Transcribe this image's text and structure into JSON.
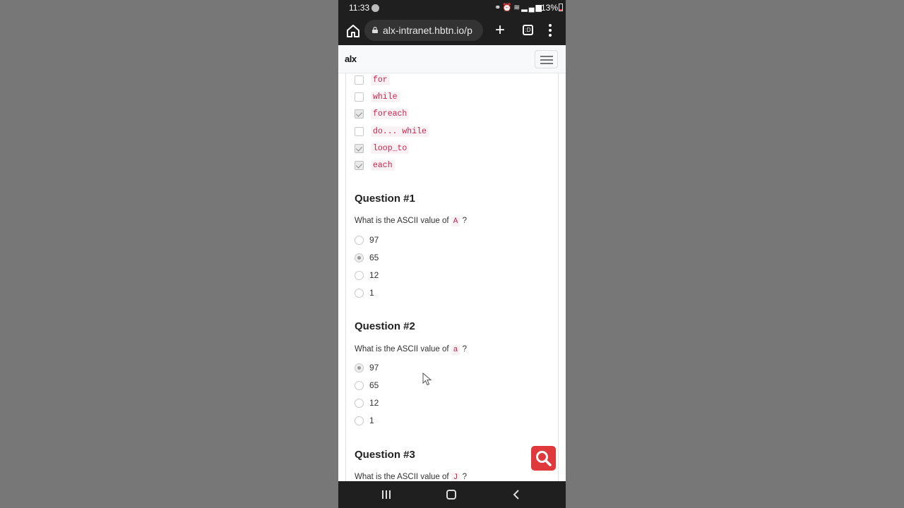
{
  "status_bar": {
    "time": "11:33",
    "battery": "13%"
  },
  "browser": {
    "url": "alx-intranet.hbtn.io/p",
    "tab_count": ":D"
  },
  "site": {
    "logo": "alx"
  },
  "loop_options": [
    {
      "label": "for",
      "checked": false
    },
    {
      "label": "while",
      "checked": false
    },
    {
      "label": "foreach",
      "checked": true
    },
    {
      "label": "do... while",
      "checked": false
    },
    {
      "label": "loop_to",
      "checked": true
    },
    {
      "label": "each",
      "checked": true
    }
  ],
  "questions": [
    {
      "title": "Question #1",
      "text_before": "What is the ASCII value of",
      "code": "A",
      "text_after": "?",
      "options": [
        {
          "label": "97",
          "selected": false
        },
        {
          "label": "65",
          "selected": true
        },
        {
          "label": "12",
          "selected": false
        },
        {
          "label": "1",
          "selected": false
        }
      ]
    },
    {
      "title": "Question #2",
      "text_before": "What is the ASCII value of",
      "code": "a",
      "text_after": "?",
      "options": [
        {
          "label": "97",
          "selected": true
        },
        {
          "label": "65",
          "selected": false
        },
        {
          "label": "12",
          "selected": false
        },
        {
          "label": "1",
          "selected": false
        }
      ]
    },
    {
      "title": "Question #3",
      "text_before": "What is the ASCII value of",
      "code": "J",
      "text_after": "?"
    }
  ],
  "colors": {
    "code_text": "#c7254e",
    "fab": "#e0393c",
    "chrome_bg": "#1f1f1f"
  },
  "icons": {
    "fab": "search-icon",
    "home": "home-icon",
    "lock": "lock-icon",
    "new_tab": "plus-icon",
    "menu": "kebab-menu-icon"
  }
}
